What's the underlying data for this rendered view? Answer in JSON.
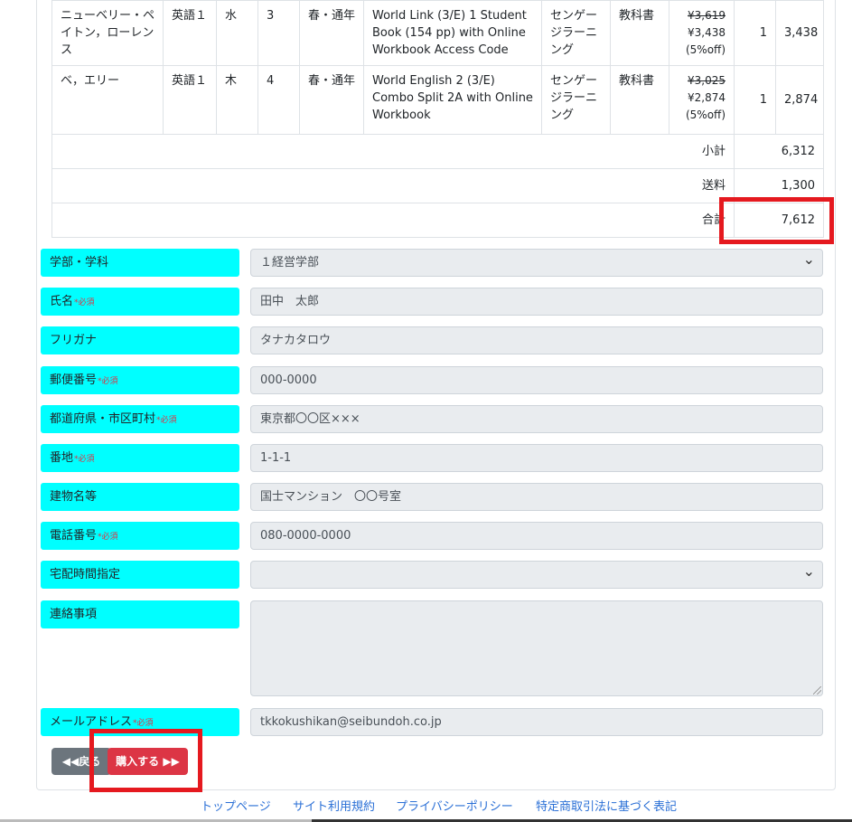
{
  "order_items": [
    {
      "name": "ニューベリー・ペイトン，ローレンス",
      "subject": "英語１",
      "day": "水",
      "period": "3",
      "term": "春・通年",
      "title": "World Link (3/E) 1 Student Book (154 pp) with Online Workbook Access Code",
      "publisher": "センゲージラーニング",
      "category": "教科書",
      "list_price": "¥3,619",
      "sale_price": "¥3,438",
      "discount": "(5%off)",
      "qty": "1",
      "amount": "3,438"
    },
    {
      "name": "ベ，エリー",
      "subject": "英語１",
      "day": "木",
      "period": "4",
      "term": "春・通年",
      "title": "World English 2 (3/E) Combo Split 2A with Online Workbook",
      "publisher": "センゲージラーニング",
      "category": "教科書",
      "list_price": "¥3,025",
      "sale_price": "¥2,874",
      "discount": "(5%off)",
      "qty": "1",
      "amount": "2,874"
    }
  ],
  "totals": {
    "subtotal_label": "小計",
    "subtotal": "6,312",
    "shipping_label": "送料",
    "shipping": "1,300",
    "total_label": "合計",
    "total": "7,612"
  },
  "form": {
    "required_mark": "必須",
    "faculty": {
      "label": "学部・学科",
      "value": "１経営学部"
    },
    "name": {
      "label": "氏名",
      "value": "田中　太郎"
    },
    "kana": {
      "label": "フリガナ",
      "value": "タナカタロウ"
    },
    "zip": {
      "label": "郵便番号",
      "value": "000-0000"
    },
    "city": {
      "label": "都道府県・市区町村",
      "value": "東京都〇〇区×××"
    },
    "street": {
      "label": "番地",
      "value": "1-1-1"
    },
    "building": {
      "label": "建物名等",
      "value": "国士マンション　〇〇号室"
    },
    "phone": {
      "label": "電話番号",
      "value": "080-0000-0000"
    },
    "delivery_time": {
      "label": "宅配時間指定",
      "value": ""
    },
    "notes": {
      "label": "連絡事項",
      "value": ""
    },
    "email": {
      "label": "メールアドレス",
      "value": "tkkokushikan@seibundoh.co.jp"
    }
  },
  "buttons": {
    "back": "戻る",
    "purchase": "購入する"
  },
  "footer": {
    "top": "トップページ",
    "terms": "サイト利用規約",
    "privacy": "プライバシーポリシー",
    "commerce": "特定商取引法に基づく表記"
  },
  "colors": {
    "label_bg": "#00ffff",
    "purchase_btn": "#dc3545",
    "back_btn": "#6c757d",
    "highlight": "#e5191f"
  }
}
